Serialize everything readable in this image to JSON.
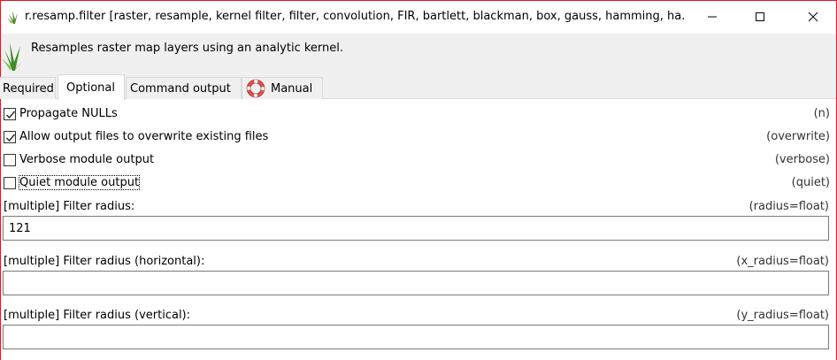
{
  "window": {
    "title": "r.resamp.filter [raster, resample, kernel filter, filter, convolution, FIR, bartlett, blackman, box, gauss, hamming, ha...",
    "description": "Resamples raster map layers using an analytic kernel.",
    "close_color": "#e81123"
  },
  "tabs": [
    {
      "label": "Required",
      "active": false
    },
    {
      "label": "Optional",
      "active": true
    },
    {
      "label": "Command output",
      "active": false
    },
    {
      "label": "Manual",
      "active": false,
      "icon": "lifebuoy-icon"
    }
  ],
  "options": [
    {
      "label": "Propagate NULLs",
      "flag": "(n)",
      "checked": true
    },
    {
      "label": "Allow output files to overwrite existing files",
      "flag": "(overwrite)",
      "checked": true
    },
    {
      "label": "Verbose module output",
      "flag": "(verbose)",
      "checked": false
    },
    {
      "label": "Quiet module output",
      "flag": "(quiet)",
      "checked": false
    }
  ],
  "fields": [
    {
      "label": "[multiple] Filter radius:",
      "key": "(radius=float)",
      "value": "121"
    },
    {
      "label": "[multiple] Filter radius (horizontal):",
      "key": "(x_radius=float)",
      "value": ""
    },
    {
      "label": "[multiple] Filter radius (vertical):",
      "key": "(y_radius=float)",
      "value": ""
    }
  ]
}
